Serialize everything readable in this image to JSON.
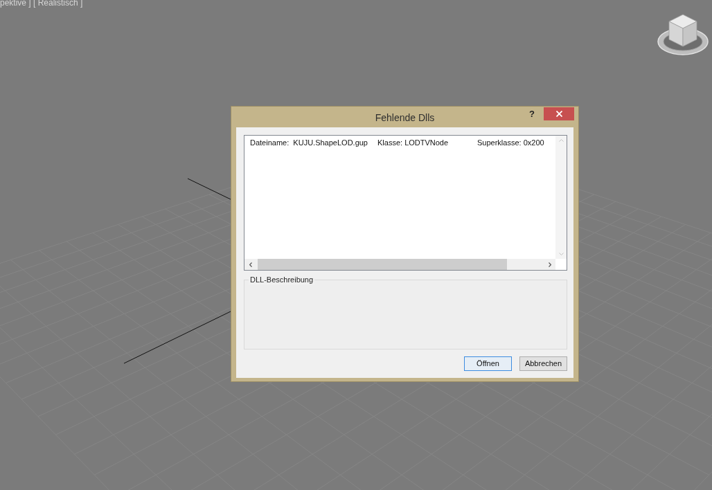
{
  "viewport": {
    "label": "pektive ] [ Realistisch ]"
  },
  "dialog": {
    "title": "Fehlende Dlls",
    "help": "?",
    "list": {
      "rows": [
        {
          "cells": [
            "Dateiname:  KUJU.ShapeLOD.gup",
            "Klasse: LODTVNode",
            "Superklasse: 0x200"
          ]
        }
      ]
    },
    "description": {
      "label": "DLL-Beschreibung"
    },
    "buttons": [
      {
        "label": "Öffnen",
        "default": true
      },
      {
        "label": "Abbrechen",
        "default": false
      }
    ]
  }
}
